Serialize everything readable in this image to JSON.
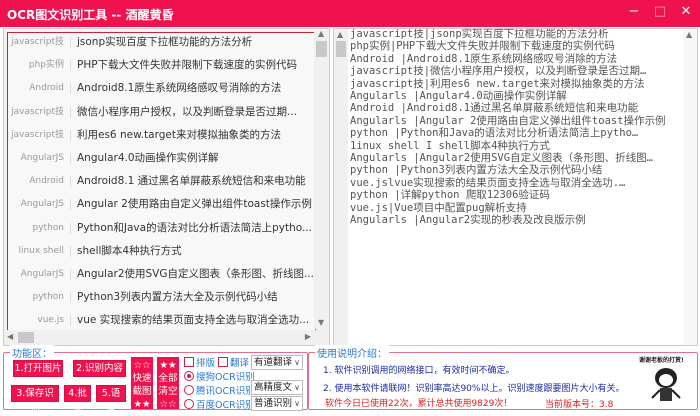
{
  "window": {
    "title": "OCR图文识别工具 -- 酒醒黄昏",
    "minimize": "−",
    "maximize": "□",
    "close": "✕"
  },
  "article_list": [
    {
      "category": "javascript技",
      "title": "jsonp实现百度下拉框功能的方法分析"
    },
    {
      "category": "php实例",
      "title": "PHP下载大文件失败并限制下载速度的实例代码"
    },
    {
      "category": "Android",
      "title": "Android8.1原生系统网络感叹号消除的方法"
    },
    {
      "category": "javascript技",
      "title": "微信小程序用户授权，以及判断登录是否过期..."
    },
    {
      "category": "javascript技",
      "title": "利用es6 new.target来对模拟抽象类的方法"
    },
    {
      "category": "AngularJS",
      "title": "Angular4.0动画操作实例详解"
    },
    {
      "category": "Android",
      "title": "Android8.1 通过黑名单屏蔽系统短信和来电功能"
    },
    {
      "category": "AngularJS",
      "title": "Angular 2使用路由自定义弹出组件toast操作示例"
    },
    {
      "category": "python",
      "title": "Python和Java的语法对比分析语法简洁上pytho..."
    },
    {
      "category": "linux shell",
      "title": "shell脚本4种执行方式"
    },
    {
      "category": "AngularJS",
      "title": "Angular2使用SVG自定义图表（条形图、折线图..."
    },
    {
      "category": "python",
      "title": "Python3列表内置方法大全及示例代码小结"
    },
    {
      "category": "vue.js",
      "title": "vue 实现搜索的结果页面支持全选与取消全选功..."
    },
    {
      "category": "python",
      "title": "详解python 爬取12306验证码"
    }
  ],
  "ocr_text": "javascript技|jsonp实现百度下拉框功能的方法分析\nphp实例|PHP下载大文件失败并限制下载速度的实例代码\nAndroid |Android8.1原生系统网络感叹号消除的方法\njavascript技|微信小程序用户授权，以及判断登录是否过期…\njavascript技|利用es6 new.target来对模拟抽象类的方法\nAngularls |Angular4.0动画操作实例详解\nAndroid |Android8.1通过黑名单屏蔽系统短信和来电功能\nAngularls |Angular 2使用路由自定义弹出组件toast操作示例\npython |Python和Java的语法对比分析语法简洁上pytho…\n1inux shell I shell脚本4种执行方式\nAngularls |Angular2使用SVG自定义图表（条形图、折线图…\npython |Python3列表内置方法大全及示例代码小结\nvue.jslvue实现搜索的结果页面支持全选与取消全选功.…\npython |详解python 爬取12306验证码\nvue.js|Vue项目中配置pug解析支持\nAngularls |Angular2实现的秒表及改良版示例",
  "functions": {
    "legend": "功能区：",
    "open_image": "1.打开图片",
    "recognize": "2.识别内容",
    "save": "3.保存识别",
    "batch": "4.批量",
    "voice": "5.语音",
    "quick_capture": [
      "☆☆",
      "快速",
      "截图",
      "★★"
    ],
    "clear_all": [
      "★★",
      "全部",
      "清空",
      "☆☆"
    ],
    "layout_label": "排版",
    "translate_label": "翻译",
    "engines": [
      {
        "label": "搜狗OCR识别",
        "selected": true
      },
      {
        "label": "腾讯OCR识别",
        "selected": false
      },
      {
        "label": "百度OCR识别",
        "selected": false
      }
    ],
    "translate_select": "有道翻译",
    "quality_select": "高精度文",
    "mode_select": "普通识别"
  },
  "instructions": {
    "legend": "使用说明介绍：",
    "line1": "1. 软件识别调用的网络接口，有效时间不确定。",
    "line2": "2. 使用本软件请联网！识别率高达90%以上。识别速度跟要图片大小有关。",
    "usage": "软件今日已使用22次，累计总共使用9829次！",
    "version": "当前版本号：3.8",
    "donate": "谢谢老板的打赏!"
  },
  "colors": {
    "accent": "#f0124e",
    "link": "#2a7ad5",
    "info": "#1a2aa8",
    "warn": "#e02020"
  }
}
